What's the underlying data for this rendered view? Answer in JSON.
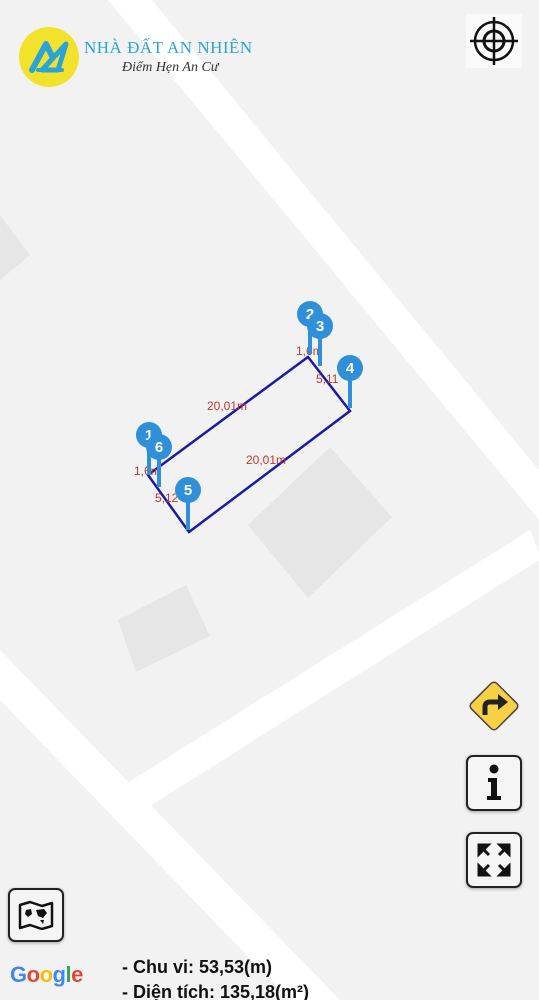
{
  "brand": {
    "name": "NHÀ ĐẤT AN NHIÊN",
    "tagline": "Điểm Hẹn An Cư",
    "logo_icon": "an-logo-icon",
    "primary_color": "#2aa3d6",
    "logo_bg_color": "#f2e22b"
  },
  "map": {
    "background_color": "#f2f2f2",
    "road_color": "#ffffff",
    "building_color": "#e6e6e6",
    "parcel": {
      "stroke_color": "#1a1aa8",
      "label_color": "#c0392b",
      "edges": [
        {
          "label": "20,01m"
        },
        {
          "label": "20,01m"
        },
        {
          "label": "1,6m"
        },
        {
          "label": "1,6m"
        },
        {
          "label": "5,11"
        },
        {
          "label": "5,12"
        }
      ],
      "markers": [
        {
          "label": "1"
        },
        {
          "label": "2"
        },
        {
          "label": "3"
        },
        {
          "label": "4"
        },
        {
          "label": "5"
        },
        {
          "label": "6"
        }
      ],
      "marker_color": "#2f8fd8"
    }
  },
  "controls": {
    "locate": {
      "icon": "crosshair-icon"
    },
    "directions": {
      "icon": "turn-right-arrow-icon",
      "color": "#f7d046"
    },
    "info": {
      "icon": "info-icon"
    },
    "fullscreen": {
      "icon": "expand-icon"
    },
    "map_type": {
      "icon": "world-map-icon"
    }
  },
  "attribution": {
    "google_letters": [
      "G",
      "o",
      "o",
      "g",
      "l",
      "e"
    ],
    "google_colors": [
      "#4285F4",
      "#EA4335",
      "#FBBC05",
      "#4285F4",
      "#34A853",
      "#EA4335"
    ]
  },
  "measurements": {
    "perimeter": "- Chu vi: 53,53(m)",
    "area": "- Diện tích: 135,18(m²)"
  }
}
